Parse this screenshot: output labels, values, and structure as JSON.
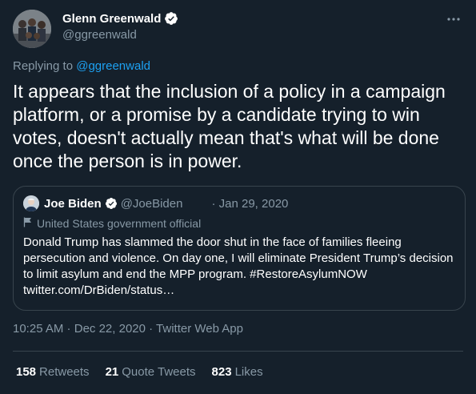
{
  "author": {
    "name": "Glenn Greenwald",
    "handle": "@ggreenwald"
  },
  "replying": {
    "prefix": "Replying to",
    "handle": "@ggreenwald"
  },
  "tweet": {
    "text": "It appears that the inclusion of a policy in a campaign platform, or a promise by a candidate trying to win votes, doesn't actually mean that's what will be done once the person is in power."
  },
  "quote": {
    "name": "Joe Biden",
    "handle": "@JoeBiden",
    "date": "· Jan 29, 2020",
    "label": "United States government official",
    "text": "Donald Trump has slammed the door shut in the face of families fleeing persecution and violence. On day one, I will eliminate President Trump’s decision to limit asylum and end the MPP program. #RestoreAsylumNOW twitter.com/DrBiden/status…"
  },
  "meta": {
    "time": "10:25 AM",
    "sep1": " · ",
    "date": "Dec 22, 2020",
    "sep2": " · ",
    "source": "Twitter Web App"
  },
  "stats": [
    {
      "count": "158",
      "label": "Retweets"
    },
    {
      "count": "21",
      "label": "Quote Tweets"
    },
    {
      "count": "823",
      "label": "Likes"
    }
  ],
  "colors": {
    "background": "#15202b",
    "accent": "#1da1f2",
    "secondary_text": "#8899a6",
    "border": "#38444d"
  },
  "icons": [
    "verified-badge-icon",
    "more-icon",
    "government-flag-icon"
  ]
}
